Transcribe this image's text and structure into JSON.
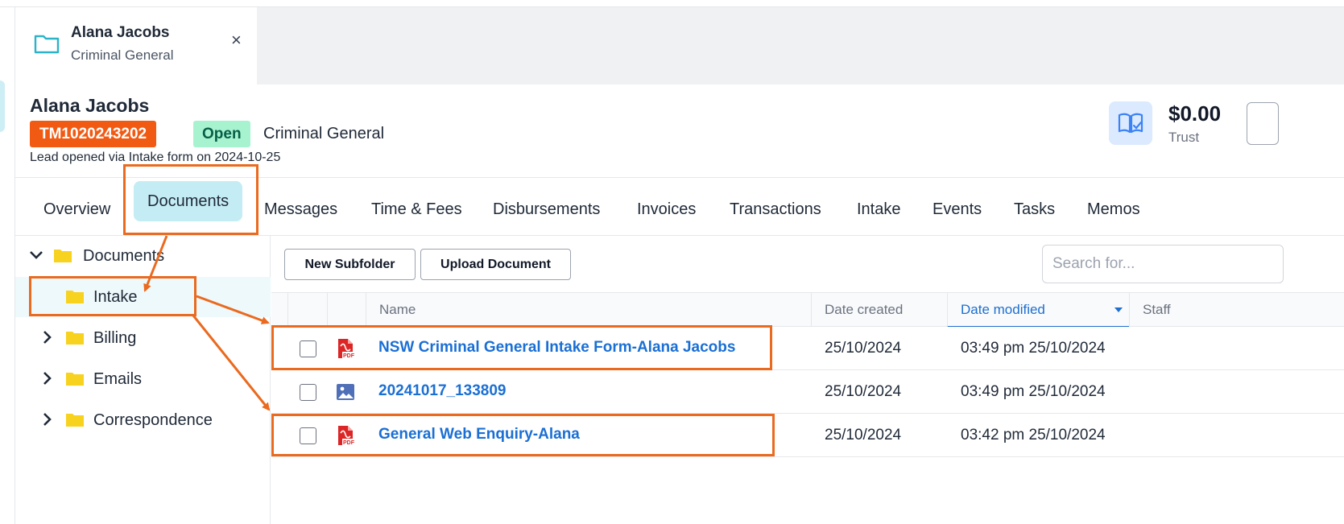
{
  "file_tab": {
    "name": "Alana Jacobs",
    "subtitle": "Criminal General",
    "close_label": "×",
    "icon": "folder-outline-icon"
  },
  "matter": {
    "name": "Alana Jacobs",
    "id": "TM1020243202",
    "status": "Open",
    "type": "Criminal General",
    "lead_note": "Lead opened via Intake form on 2024-10-25",
    "trust_amount": "$0.00",
    "trust_label": "Trust",
    "trust_icon": "book-check-icon"
  },
  "nav": {
    "tabs": [
      {
        "label": "Overview"
      },
      {
        "label": "Documents",
        "active": true
      },
      {
        "label": "Messages"
      },
      {
        "label": "Time & Fees"
      },
      {
        "label": "Disbursements"
      },
      {
        "label": "Invoices"
      },
      {
        "label": "Transactions"
      },
      {
        "label": "Intake"
      },
      {
        "label": "Events"
      },
      {
        "label": "Tasks"
      },
      {
        "label": "Memos"
      }
    ]
  },
  "tree": {
    "root": {
      "label": "Documents",
      "expanded": true
    },
    "items": [
      {
        "label": "Intake",
        "selected": true
      },
      {
        "label": "Billing"
      },
      {
        "label": "Emails"
      },
      {
        "label": "Correspondence"
      }
    ]
  },
  "toolbar": {
    "new_subfolder": "New Subfolder",
    "upload_document": "Upload Document",
    "search_placeholder": "Search for..."
  },
  "table": {
    "columns": [
      "Name",
      "Date created",
      "Date modified",
      "Staff"
    ],
    "sorted_column": "Date modified",
    "rows": [
      {
        "name": "NSW Criminal General Intake Form-Alana Jacobs",
        "type": "pdf",
        "date_created": "25/10/2024",
        "date_modified": "03:49 pm 25/10/2024"
      },
      {
        "name": "20241017_133809",
        "type": "image",
        "date_created": "25/10/2024",
        "date_modified": "03:49 pm 25/10/2024"
      },
      {
        "name": "General Web Enquiry-Alana",
        "type": "pdf",
        "date_created": "25/10/2024",
        "date_modified": "03:42 pm 25/10/2024"
      }
    ]
  },
  "colors": {
    "accent_teal": "#c4ecf4",
    "id_badge": "#f15a13",
    "open_badge": "#a7f3d0",
    "link_blue": "#1a6fd4",
    "annotation_orange": "#ea6a1f",
    "folder_yellow": "#f7d21e"
  }
}
